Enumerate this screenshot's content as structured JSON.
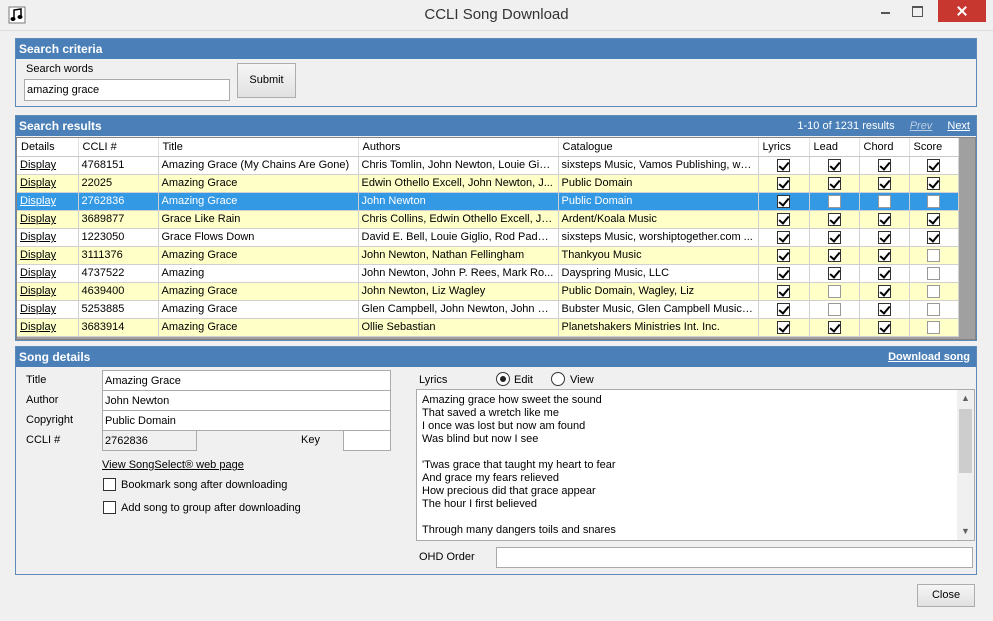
{
  "window": {
    "title": "CCLI Song Download"
  },
  "search": {
    "header": "Search criteria",
    "words_label": "Search words",
    "words_value": "amazing grace",
    "submit_label": "Submit"
  },
  "results": {
    "header": "Search results",
    "summary": "1-10 of 1231 results",
    "prev_label": "Prev",
    "next_label": "Next",
    "columns": [
      "Details",
      "CCLI #",
      "Title",
      "Authors",
      "Catalogue",
      "Lyrics",
      "Lead",
      "Chord",
      "Score"
    ],
    "rows": [
      {
        "details": "Display",
        "ccli": "4768151",
        "title": "Amazing Grace (My Chains Are Gone)",
        "authors": "Chris Tomlin, John Newton, Louie Giglio",
        "catalogue": "sixsteps Music, Vamos Publishing, wo...",
        "lyrics": true,
        "lead": true,
        "chord": true,
        "score": true
      },
      {
        "details": "Display",
        "ccli": "22025",
        "title": "Amazing Grace",
        "authors": "Edwin Othello Excell, John Newton, J...",
        "catalogue": "Public Domain",
        "lyrics": true,
        "lead": true,
        "chord": true,
        "score": true
      },
      {
        "details": "Display",
        "ccli": "2762836",
        "title": "Amazing Grace",
        "authors": "John Newton",
        "catalogue": "Public Domain",
        "lyrics": true,
        "lead": false,
        "chord": false,
        "score": false
      },
      {
        "details": "Display",
        "ccli": "3689877",
        "title": "Grace Like Rain",
        "authors": "Chris Collins, Edwin Othello Excell, Jo...",
        "catalogue": "Ardent/Koala Music",
        "lyrics": true,
        "lead": true,
        "chord": true,
        "score": true
      },
      {
        "details": "Display",
        "ccli": "1223050",
        "title": "Grace Flows Down",
        "authors": "David E. Bell, Louie Giglio, Rod Padgett",
        "catalogue": "sixsteps Music, worshiptogether.com ...",
        "lyrics": true,
        "lead": true,
        "chord": true,
        "score": true
      },
      {
        "details": "Display",
        "ccli": "3111376",
        "title": "Amazing Grace",
        "authors": "John Newton, Nathan Fellingham",
        "catalogue": "Thankyou Music",
        "lyrics": true,
        "lead": true,
        "chord": true,
        "score": false
      },
      {
        "details": "Display",
        "ccli": "4737522",
        "title": "Amazing",
        "authors": "John Newton, John P. Rees, Mark Ro...",
        "catalogue": "Dayspring Music, LLC",
        "lyrics": true,
        "lead": true,
        "chord": true,
        "score": false
      },
      {
        "details": "Display",
        "ccli": "4639400",
        "title": "Amazing Grace",
        "authors": "John Newton, Liz Wagley",
        "catalogue": "Public Domain, Wagley, Liz",
        "lyrics": true,
        "lead": false,
        "chord": true,
        "score": false
      },
      {
        "details": "Display",
        "ccli": "5253885",
        "title": "Amazing Grace",
        "authors": "Glen Campbell, John Newton, John P....",
        "catalogue": "Bubster Music, Glen Campbell Music, I...",
        "lyrics": true,
        "lead": false,
        "chord": true,
        "score": false
      },
      {
        "details": "Display",
        "ccli": "3683914",
        "title": "Amazing Grace",
        "authors": "Ollie Sebastian",
        "catalogue": "Planetshakers Ministries Int. Inc.",
        "lyrics": true,
        "lead": true,
        "chord": true,
        "score": false
      }
    ],
    "selected_row": 2
  },
  "details": {
    "header": "Song details",
    "download_label": "Download song",
    "title_label": "Title",
    "title_value": "Amazing Grace",
    "author_label": "Author",
    "author_value": "John Newton",
    "copyright_label": "Copyright",
    "copyright_value": "Public Domain",
    "ccli_label": "CCLI #",
    "ccli_value": "2762836",
    "key_label": "Key",
    "key_value": "",
    "songselect_link": "View SongSelect® web page",
    "bookmark_label": "Bookmark song after downloading",
    "group_label": "Add song to group after downloading",
    "lyrics_label": "Lyrics",
    "edit_label": "Edit",
    "view_label": "View",
    "lyrics_lines": [
      "Amazing grace how sweet the sound",
      "That saved a wretch like me",
      "I once was lost but now am found",
      "Was blind but now I see",
      "",
      "'Twas grace that taught my heart to fear",
      "And grace my fears relieved",
      "How precious did that grace appear",
      "The hour I first believed",
      "",
      "Through many dangers toils and snares"
    ],
    "ohd_label": "OHD Order",
    "ohd_value": ""
  },
  "footer": {
    "close_label": "Close"
  }
}
